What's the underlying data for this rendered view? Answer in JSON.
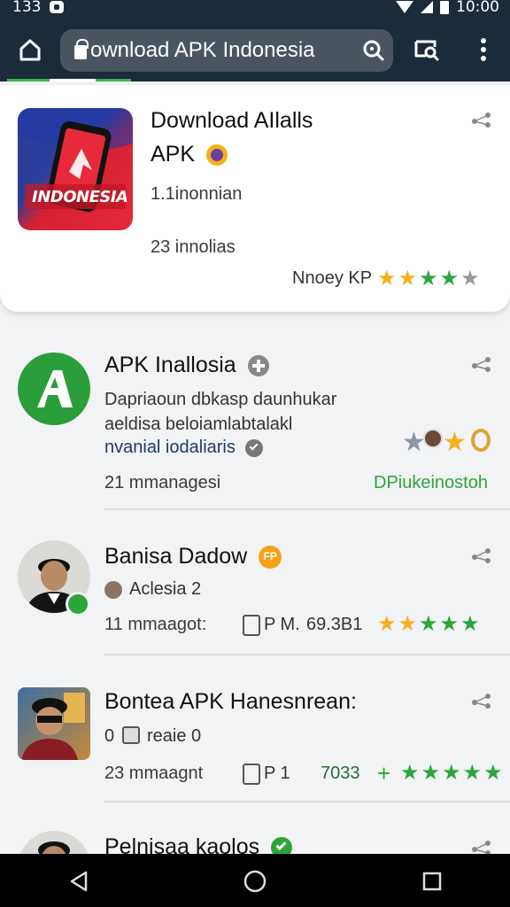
{
  "status_bar": {
    "time_left": "133",
    "time_right": "10:00"
  },
  "browser": {
    "url": "ownload APK Indonesia"
  },
  "featured": {
    "title_line1": "Download AIlalls",
    "title_line2": "APK",
    "app_icon_label": "INDONESIA",
    "meta1": "1.1inonnian",
    "meta2": "23 innolias",
    "rating_label": "Nnoey KP",
    "stars": [
      "gold",
      "gold",
      "green",
      "green",
      "gray"
    ]
  },
  "items": [
    {
      "title": "APK Inallosia",
      "desc1": "Dapriaoun dbkasp daunhukar",
      "desc2": "aeldisa beloiamlabtalakl",
      "desc3": "nvanial iodaliaris",
      "meta": "21 mmanagesi",
      "action": "DPiukeinostoh"
    },
    {
      "title": "Banisa Dadow",
      "badge": "FP",
      "sub": "Aclesia 2",
      "meta": "11 mmaagot:",
      "label_mid": "P M.",
      "count": "69.3B1",
      "stars": [
        "gold",
        "gold",
        "green",
        "green",
        "green"
      ]
    },
    {
      "title": "Bontea APK Hanesnrean:",
      "sub_prefix": "0",
      "sub": "reaie 0",
      "meta": "23 mmaagnt",
      "label_mid": "P 1",
      "count": "7033",
      "stars": [
        "green",
        "green",
        "green",
        "green",
        "green"
      ],
      "plus": "+"
    },
    {
      "title": "Pelnisaa kaolos"
    }
  ],
  "colors": {
    "toolbar": "#1c2b3a",
    "green": "#2ca53a",
    "gold": "#f5b01a"
  }
}
